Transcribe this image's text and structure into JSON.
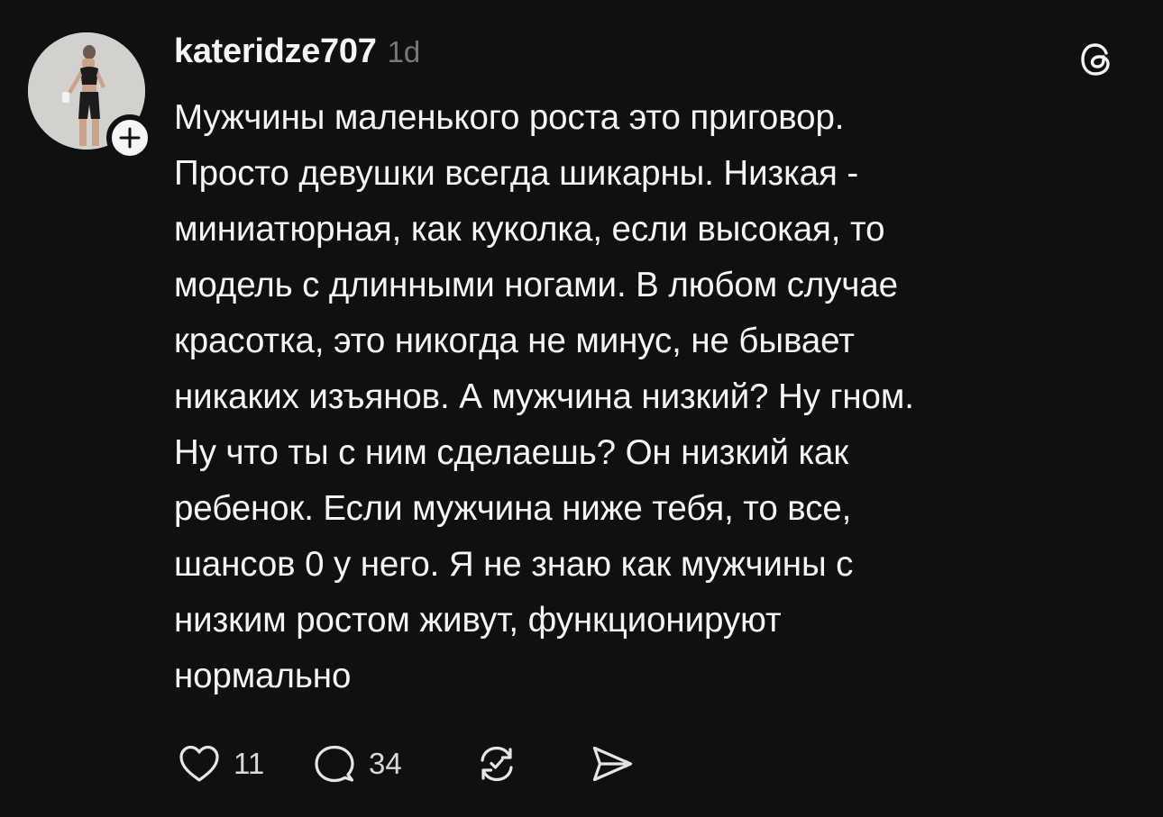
{
  "post": {
    "author": {
      "username": "kateridze707",
      "time_ago": "1d",
      "avatar": "profile-photo",
      "follow_icon": "plus-icon"
    },
    "app_icon": "threads-logo-icon",
    "text": "Мужчины маленького роста это приговор.\nПросто девушки всегда шикарны. Низкая -\nминиатюрная, как куколка, если высокая, то\nмодель с длинными ногами. В любом случае\nкрасотка, это никогда не минус, не бывает\nникаких изъянов. А мужчина низкий? Ну гном.\nНу что ты с ним сделаешь? Он низкий как\nребенок. Если мужчина ниже тебя, то все,\nшансов 0 у него. Я не знаю как мужчины с\nнизким ростом живут, функционируют\nнормально",
    "actions": {
      "like": {
        "icon": "heart-icon",
        "count": "11"
      },
      "reply": {
        "icon": "comment-icon",
        "count": "34"
      },
      "repost": {
        "icon": "repost-icon"
      },
      "share": {
        "icon": "send-icon"
      }
    }
  },
  "colors": {
    "background": "#101010",
    "text": "#f3f5f7",
    "secondary": "#777777"
  }
}
